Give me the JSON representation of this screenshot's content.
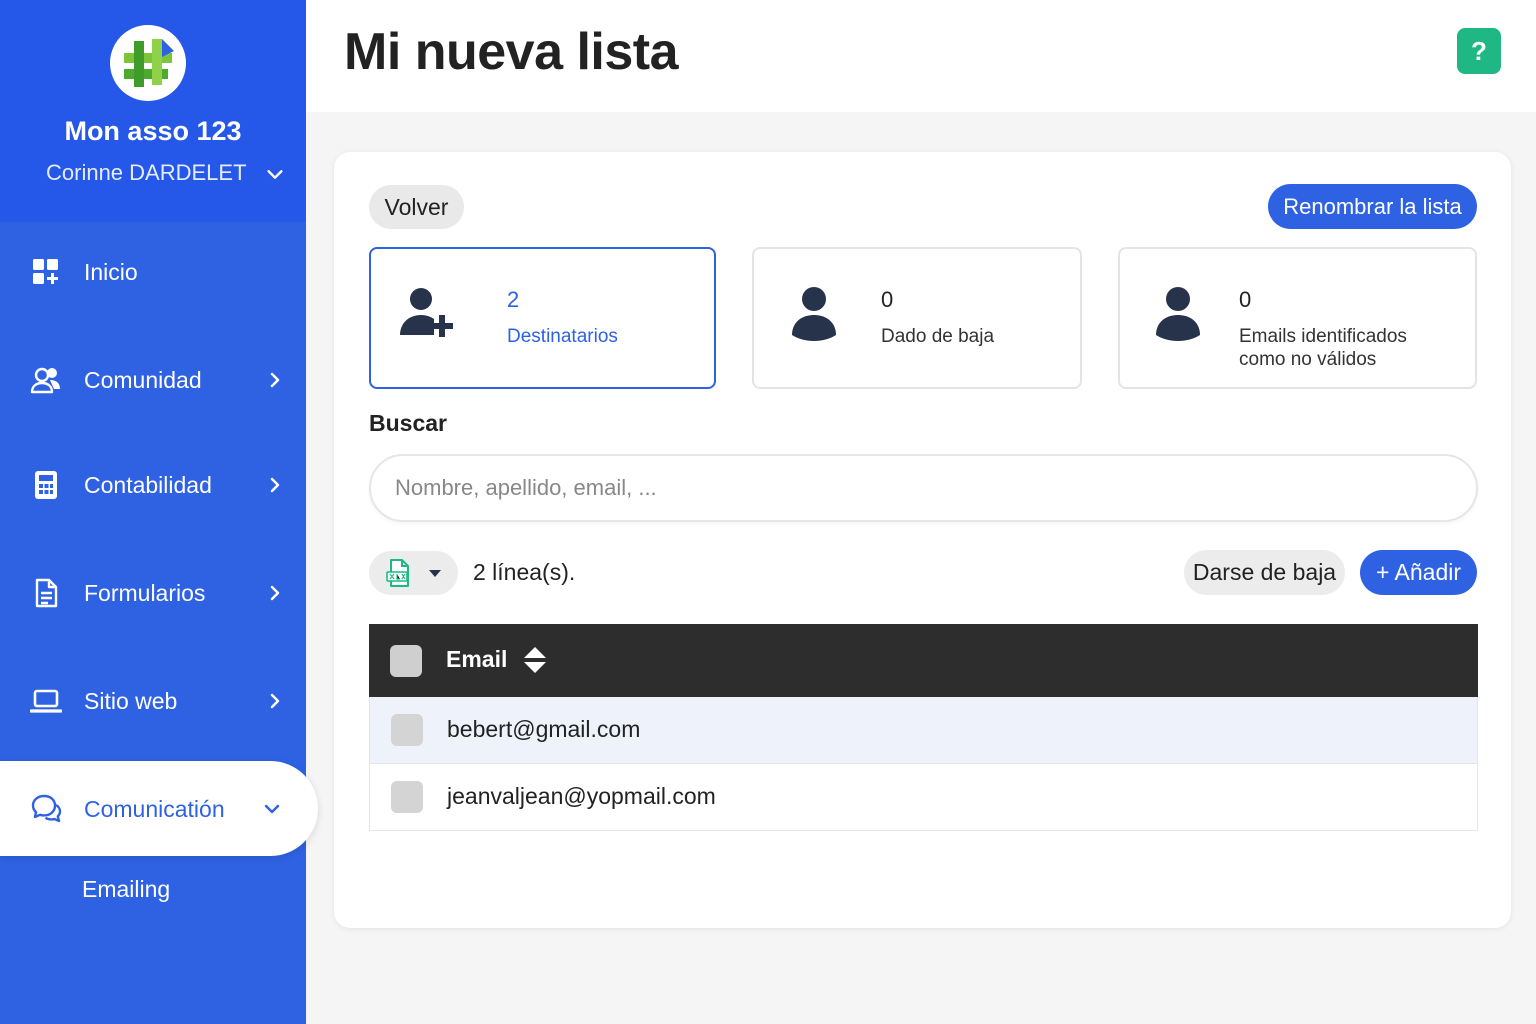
{
  "sidebar": {
    "org_name": "Mon asso 123",
    "user_name": "Corinne DARDELET",
    "items": [
      {
        "label": "Inicio",
        "icon": "dashboard-icon"
      },
      {
        "label": "Comunidad",
        "icon": "users-icon"
      },
      {
        "label": "Contabilidad",
        "icon": "calculator-icon"
      },
      {
        "label": "Formularios",
        "icon": "document-icon"
      },
      {
        "label": "Sitio web",
        "icon": "laptop-icon"
      },
      {
        "label": "Comunicatión",
        "icon": "chat-icon",
        "active": true
      }
    ],
    "sub_items": [
      {
        "label": "Emailing"
      }
    ]
  },
  "header": {
    "title": "Mi nueva lista",
    "help_label": "?"
  },
  "toolbar": {
    "back_label": "Volver",
    "rename_label": "Renombrar la lista"
  },
  "stats": [
    {
      "value": "2",
      "label": "Destinatarios",
      "icon": "user-plus-icon"
    },
    {
      "value": "0",
      "label": "Dado de baja",
      "icon": "user-icon"
    },
    {
      "value": "0",
      "label": "Emails identificados como no válidos",
      "icon": "user-icon"
    }
  ],
  "search": {
    "label": "Buscar",
    "placeholder": "Nombre, apellido, email, ..."
  },
  "list_actions": {
    "lines_count": "2 línea(s).",
    "unsubscribe_label": "Darse de baja",
    "add_label": "+ Añadir"
  },
  "table": {
    "column_email": "Email",
    "rows": [
      {
        "email": "bebert@gmail.com"
      },
      {
        "email": "jeanvaljean@yopmail.com"
      }
    ]
  },
  "colors": {
    "primary": "#2f62e3",
    "sidebar_header": "#2557e8",
    "help": "#1fb885",
    "table_header": "#2d2d2d"
  }
}
